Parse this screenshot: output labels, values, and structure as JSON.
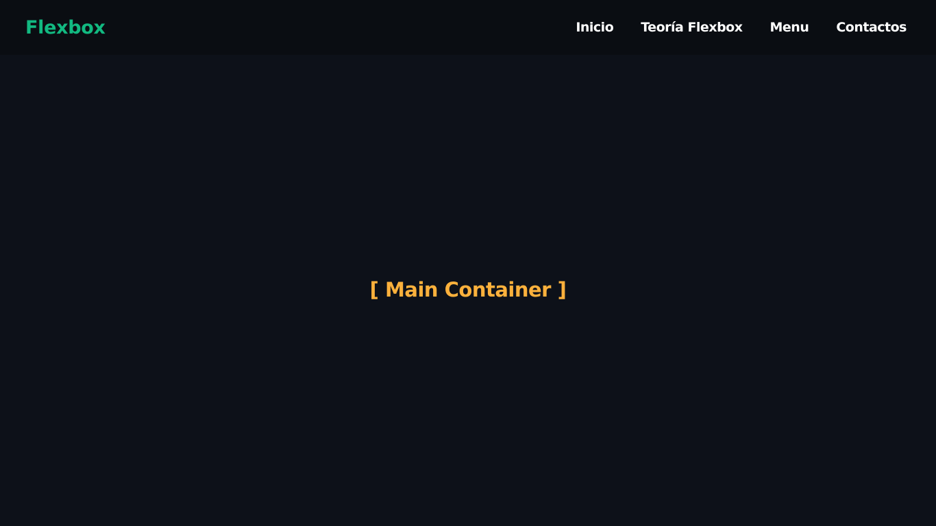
{
  "header": {
    "logo": "Flexbox",
    "nav": [
      {
        "label": "Inicio"
      },
      {
        "label": "Teoría Flexbox"
      },
      {
        "label": "Menu"
      },
      {
        "label": "Contactos"
      }
    ]
  },
  "main": {
    "label": "[ Main Container ]"
  },
  "colors": {
    "background": "#0d1119",
    "header_background": "#0a0d12",
    "logo": "#12b981",
    "nav_text": "#ffffff",
    "main_label": "#fbb13c"
  }
}
